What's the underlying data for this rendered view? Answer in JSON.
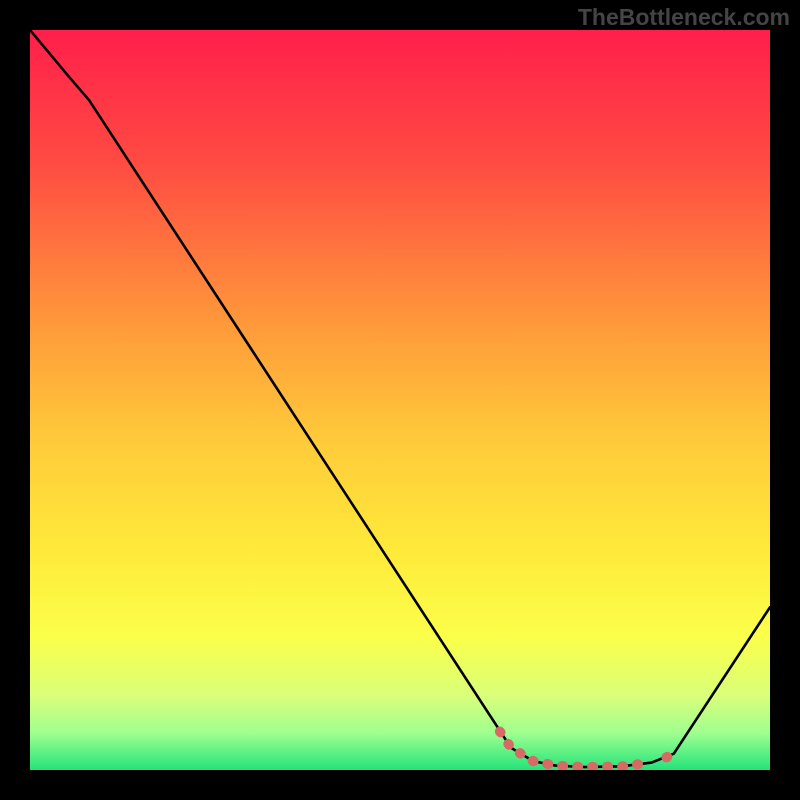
{
  "attribution": "TheBottleneck.com",
  "chart_data": {
    "type": "line",
    "title": "",
    "xlabel": "",
    "ylabel": "",
    "xlim": [
      0,
      100
    ],
    "ylim": [
      0,
      100
    ],
    "grid": false,
    "gradient_stops": [
      {
        "offset": 0,
        "color": "#ff1f4b"
      },
      {
        "offset": 18,
        "color": "#ff4b42"
      },
      {
        "offset": 40,
        "color": "#ff9a3a"
      },
      {
        "offset": 55,
        "color": "#ffc93a"
      },
      {
        "offset": 70,
        "color": "#ffe93a"
      },
      {
        "offset": 82,
        "color": "#fbff4a"
      },
      {
        "offset": 90,
        "color": "#d9ff7a"
      },
      {
        "offset": 95,
        "color": "#9fff8f"
      },
      {
        "offset": 100,
        "color": "#23e47a"
      }
    ],
    "curve": [
      {
        "x": 0,
        "y": 100
      },
      {
        "x": 5,
        "y": 94
      },
      {
        "x": 8,
        "y": 90.5
      },
      {
        "x": 65,
        "y": 3.0
      },
      {
        "x": 68,
        "y": 1.2
      },
      {
        "x": 71,
        "y": 0.6
      },
      {
        "x": 75,
        "y": 0.4
      },
      {
        "x": 80,
        "y": 0.5
      },
      {
        "x": 84,
        "y": 1.0
      },
      {
        "x": 87,
        "y": 2.2
      },
      {
        "x": 100,
        "y": 22
      }
    ],
    "highlight_segments": [
      {
        "points": [
          {
            "x": 63.5,
            "y": 5.2
          },
          {
            "x": 65,
            "y": 3.0
          },
          {
            "x": 68,
            "y": 1.2
          },
          {
            "x": 71,
            "y": 0.6
          },
          {
            "x": 75,
            "y": 0.4
          },
          {
            "x": 80,
            "y": 0.5
          },
          {
            "x": 84,
            "y": 1.0
          }
        ]
      },
      {
        "points": [
          {
            "x": 86,
            "y": 1.7
          },
          {
            "x": 87.5,
            "y": 2.6
          }
        ]
      }
    ],
    "highlight_color": "#d86a66"
  }
}
